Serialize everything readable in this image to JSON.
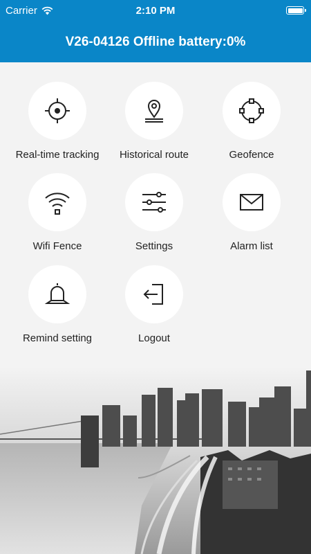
{
  "status_bar": {
    "carrier": "Carrier",
    "time": "2:10 PM"
  },
  "header": {
    "title": "V26-04126 Offline battery:0%"
  },
  "menu": {
    "items": [
      {
        "label": "Real-time tracking",
        "icon": "crosshair-icon"
      },
      {
        "label": "Historical route",
        "icon": "location-pin-icon"
      },
      {
        "label": "Geofence",
        "icon": "geofence-icon"
      },
      {
        "label": "Wifi Fence",
        "icon": "wifi-icon"
      },
      {
        "label": "Settings",
        "icon": "sliders-icon"
      },
      {
        "label": "Alarm list",
        "icon": "envelope-icon"
      },
      {
        "label": "Remind setting",
        "icon": "bell-icon"
      },
      {
        "label": "Logout",
        "icon": "logout-icon"
      }
    ]
  },
  "colors": {
    "primary": "#0a86c8",
    "background": "#f3f3f3",
    "circle": "#ffffff",
    "icon": "#222222"
  }
}
